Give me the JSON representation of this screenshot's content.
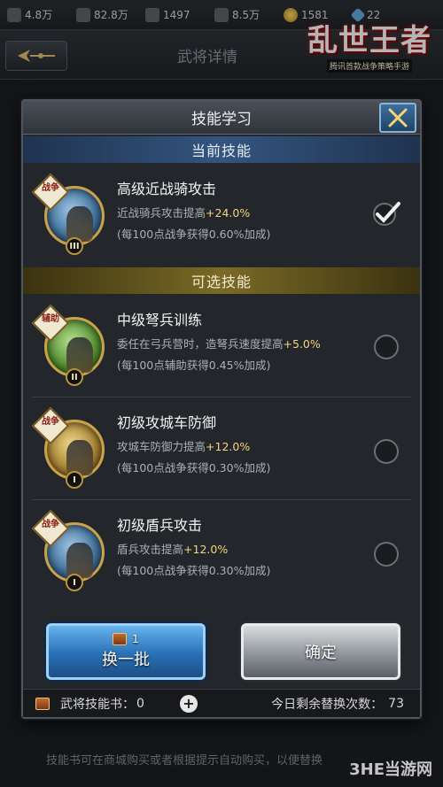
{
  "resources": [
    {
      "name": "food",
      "value": "4.8万"
    },
    {
      "name": "wood",
      "value": "82.8万"
    },
    {
      "name": "iron",
      "value": "1497"
    },
    {
      "name": "stone",
      "value": "8.5万"
    },
    {
      "name": "coins",
      "value": "1581"
    },
    {
      "name": "gems",
      "value": "22"
    }
  ],
  "background": {
    "title": "武将详情"
  },
  "logo": {
    "main": "乱世王者",
    "sub": "腾讯首款战争策略手游"
  },
  "dialog": {
    "title": "技能学习",
    "current_section": "当前技能",
    "optional_section": "可选技能",
    "current_skill": {
      "type": "战争",
      "level": "III",
      "name": "高级近战骑攻击",
      "desc_prefix": "近战骑兵攻击提高",
      "desc_value": "+24.0%",
      "note": "(每100点战争获得0.60%加成)",
      "selected": true
    },
    "options": [
      {
        "type": "辅助",
        "level": "II",
        "name": "中级弩兵训练",
        "desc_prefix": "委任在弓兵营时，造弩兵速度提高",
        "desc_value": "+5.0%",
        "note": "(每100点辅助获得0.45%加成)"
      },
      {
        "type": "战争",
        "level": "I",
        "name": "初级攻城车防御",
        "desc_prefix": "攻城车防御力提高",
        "desc_value": "+12.0%",
        "note": "(每100点战争获得0.30%加成)"
      },
      {
        "type": "战争",
        "level": "I",
        "name": "初级盾兵攻击",
        "desc_prefix": "盾兵攻击提高",
        "desc_value": "+12.0%",
        "note": "(每100点战争获得0.30%加成)"
      }
    ],
    "swap_button": {
      "cost": "1",
      "label": "换一批"
    },
    "confirm_button": {
      "label": "确定"
    },
    "footer": {
      "books_label": "武将技能书：",
      "books_value": "0",
      "remaining_label": "今日剩余替换次数：",
      "remaining_value": "73"
    }
  },
  "bottom_tip": "技能书可在商城购买或者根据提示自动购买，以便替换",
  "watermark": "3HE当游网",
  "colors": {
    "highlight": "#f2d57a",
    "current_section_bg": "#34557f",
    "optional_section_bg": "#7a6a26",
    "swap_blue": "#2a6fb6"
  }
}
